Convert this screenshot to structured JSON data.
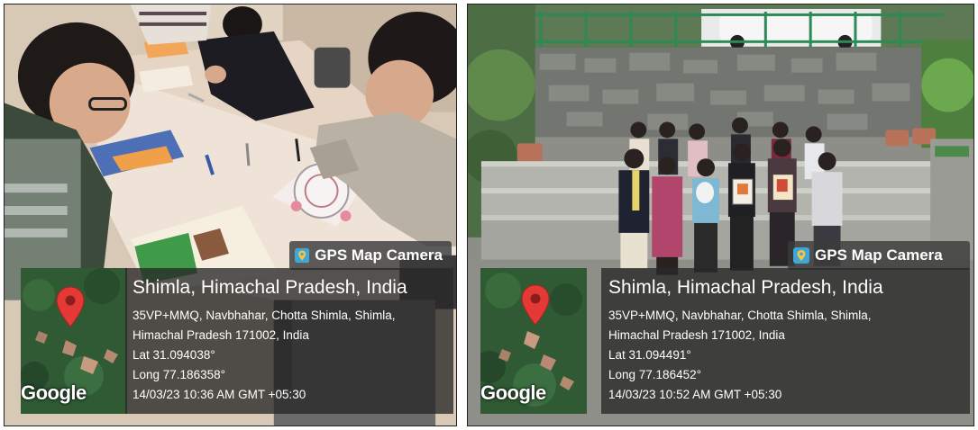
{
  "panels": [
    {
      "camera_label": "GPS Map Camera",
      "map_provider": "Google",
      "location_title": "Shimla, Himachal Pradesh, India",
      "address_line1": "35VP+MMQ, Navbhahar, Chotta Shimla, Shimla,",
      "address_line2": "Himachal Pradesh 171002, India",
      "lat": "Lat 31.094038°",
      "long": "Long 77.186358°",
      "timestamp": "14/03/23 10:36 AM GMT +05:30",
      "icons": {
        "camera": "map-camera-icon",
        "pin": "map-pin-icon"
      },
      "colors": {
        "pin": "#e53935",
        "overlay": "#333333"
      }
    },
    {
      "camera_label": "GPS Map Camera",
      "map_provider": "Google",
      "location_title": "Shimla, Himachal Pradesh, India",
      "address_line1": "35VP+MMQ, Navbhahar, Chotta Shimla, Shimla,",
      "address_line2": "Himachal Pradesh 171002, India",
      "lat": "Lat 31.094491°",
      "long": "Long 77.186452°",
      "timestamp": "14/03/23 10:52 AM GMT +05:30",
      "icons": {
        "camera": "map-camera-icon",
        "pin": "map-pin-icon"
      },
      "colors": {
        "pin": "#e53935",
        "overlay": "#333333"
      }
    }
  ]
}
